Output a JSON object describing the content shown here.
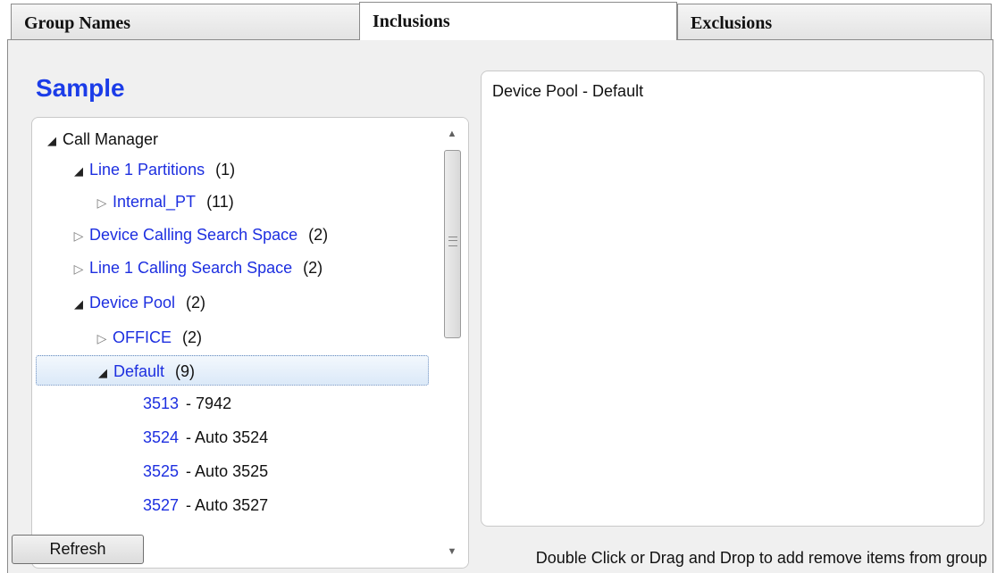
{
  "tabs": [
    {
      "label": "Group Names",
      "active": false
    },
    {
      "label": "Inclusions",
      "active": true
    },
    {
      "label": "Exclusions",
      "active": false
    }
  ],
  "sample_title": "Sample",
  "tree": [
    {
      "label": "Call Manager",
      "count": "",
      "extra": "",
      "expanded": true
    },
    {
      "label": "Line 1 Partitions",
      "count": "(1)",
      "extra": "",
      "expanded": true
    },
    {
      "label": "Internal_PT",
      "count": "(11)",
      "extra": "",
      "expanded": false
    },
    {
      "label": "Device Calling Search Space",
      "count": "(2)",
      "extra": "",
      "expanded": false
    },
    {
      "label": "Line 1 Calling Search Space",
      "count": "(2)",
      "extra": "",
      "expanded": false
    },
    {
      "label": "Device Pool",
      "count": "(2)",
      "extra": "",
      "expanded": true
    },
    {
      "label": "OFFICE",
      "count": "(2)",
      "extra": "",
      "expanded": false
    },
    {
      "label": "Default",
      "count": "(9)",
      "extra": "",
      "expanded": true,
      "selected": true
    },
    {
      "label": "3513",
      "count": "",
      "extra": "- 7942"
    },
    {
      "label": "3524",
      "count": "",
      "extra": "- Auto 3524"
    },
    {
      "label": "3525",
      "count": "",
      "extra": "- Auto 3525"
    },
    {
      "label": "3527",
      "count": "",
      "extra": "- Auto 3527"
    }
  ],
  "right_panel": {
    "items": [
      "Device Pool - Default"
    ]
  },
  "buttons": {
    "refresh": "Refresh"
  },
  "hint": "Double Click or Drag and Drop to add remove items from group",
  "colors": {
    "title_blue": "#1b3ce8",
    "link_blue": "#1d2fe0"
  },
  "icons": {
    "expanded": "triangle-expanded-icon",
    "collapsed": "triangle-collapsed-icon",
    "scroll_up": "scroll-up-arrow-icon",
    "scroll_down": "scroll-down-arrow-icon"
  }
}
